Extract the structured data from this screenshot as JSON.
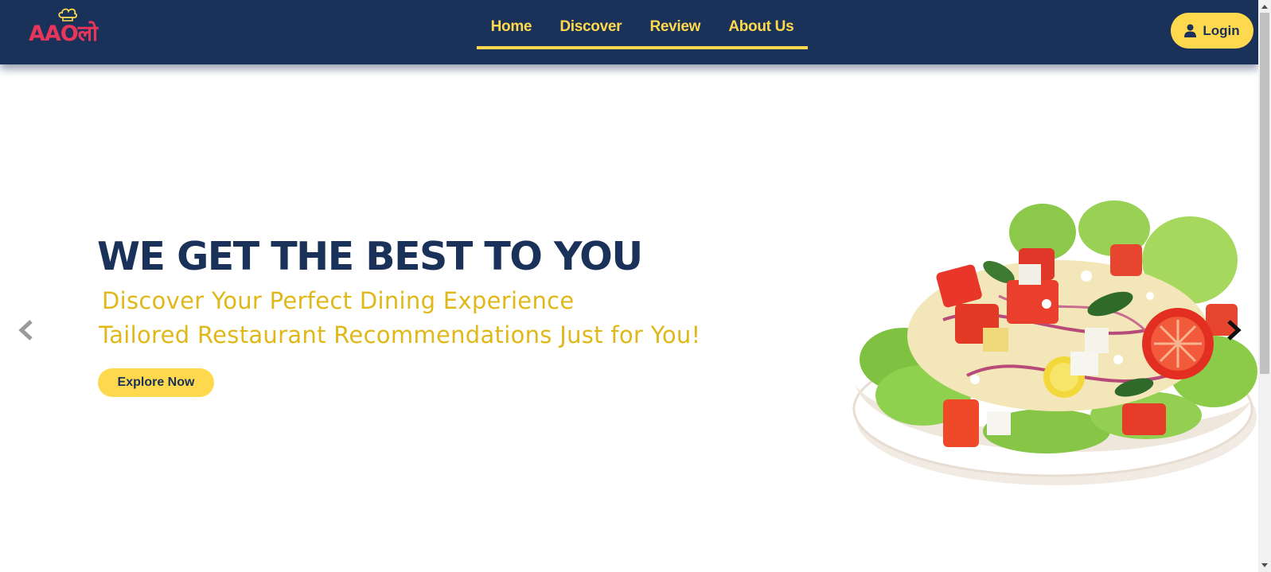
{
  "brand": {
    "logo_text": "AAOलो",
    "logo_color": "#e8365a"
  },
  "nav": {
    "items": [
      {
        "label": "Home"
      },
      {
        "label": "Discover"
      },
      {
        "label": "Review"
      },
      {
        "label": "About Us"
      }
    ],
    "active_underline_color": "#ffd94d"
  },
  "login": {
    "label": "Login",
    "icon": "user-icon"
  },
  "hero": {
    "headline": "WE GET THE BEST TO YOU",
    "subline_1": "Discover Your Perfect Dining Experience",
    "subline_2": "Tailored Restaurant Recommendations Just for You!",
    "cta_label": "Explore Now",
    "image": "salad-bowl"
  },
  "carousel": {
    "prev_icon": "chevron-left-icon",
    "next_icon": "chevron-right-icon"
  },
  "colors": {
    "navy": "#1a3159",
    "yellow": "#ffd94d",
    "gold_text": "#e0b81a"
  }
}
